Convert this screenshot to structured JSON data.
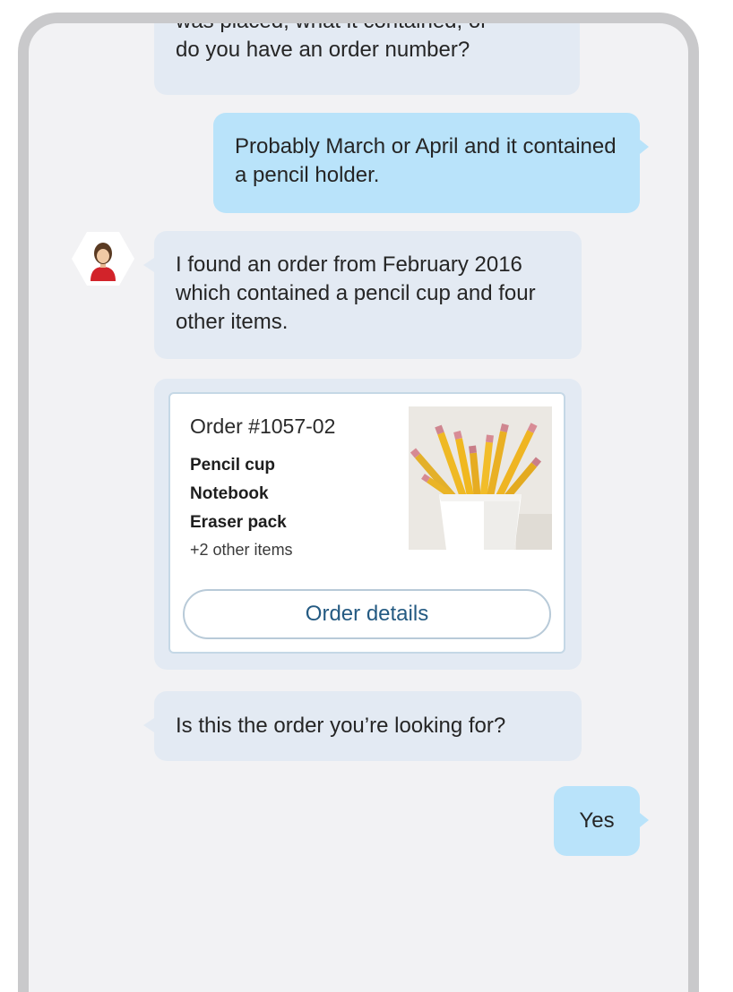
{
  "conversation": {
    "messages": [
      {
        "sender": "bot",
        "text_clipped": "was placed, what it contained, or",
        "text": "do you have an order number?"
      },
      {
        "sender": "user",
        "text": "Probably March or April and it contained a pencil holder."
      },
      {
        "sender": "bot",
        "text": "I found an order from February 2016 which contained a pencil cup and four other items."
      },
      {
        "sender": "bot",
        "text": "Is this the order you’re looking for?"
      },
      {
        "sender": "user",
        "text": "Yes"
      }
    ]
  },
  "order_card": {
    "title": "Order #1057-02",
    "items": [
      "Pencil cup",
      "Notebook",
      "Eraser pack"
    ],
    "more_items": "+2 other items",
    "button_label": "Order details",
    "image": "pencil-cup-photo"
  },
  "avatar": {
    "icon": "agent-avatar-icon"
  },
  "colors": {
    "bot_bubble": "#e3eaf3",
    "user_bubble": "#b9e3fa",
    "background": "#f2f2f4",
    "button_text": "#245a82"
  }
}
